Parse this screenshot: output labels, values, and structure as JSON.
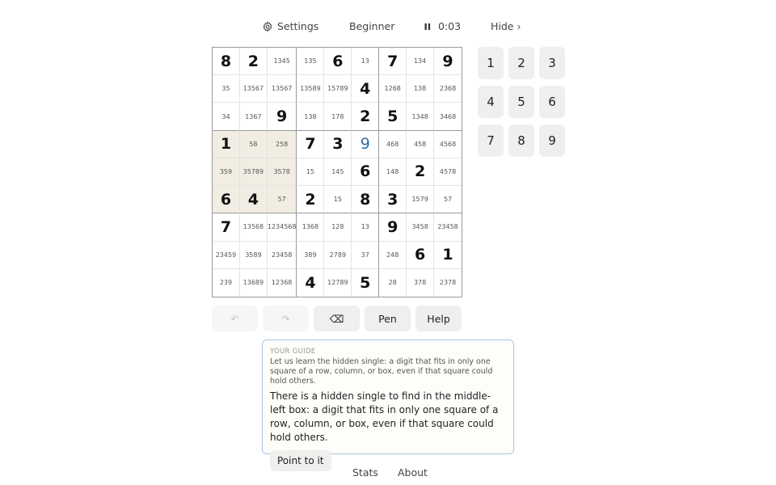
{
  "header": {
    "settings_label": "Settings",
    "difficulty": "Beginner",
    "pause_icon": "pause-icon",
    "timer": "0:03",
    "hide_label": "Hide ›"
  },
  "board": {
    "rows": [
      [
        {
          "v": "8",
          "t": "given"
        },
        {
          "v": "2",
          "t": "given"
        },
        {
          "v": "1345",
          "t": "cand"
        },
        {
          "v": "135",
          "t": "cand"
        },
        {
          "v": "6",
          "t": "given"
        },
        {
          "v": "13",
          "t": "cand"
        },
        {
          "v": "7",
          "t": "given"
        },
        {
          "v": "134",
          "t": "cand"
        },
        {
          "v": "9",
          "t": "given"
        }
      ],
      [
        {
          "v": "35",
          "t": "cand"
        },
        {
          "v": "13567",
          "t": "cand"
        },
        {
          "v": "13567",
          "t": "cand"
        },
        {
          "v": "13589",
          "t": "cand"
        },
        {
          "v": "15789",
          "t": "cand"
        },
        {
          "v": "4",
          "t": "given"
        },
        {
          "v": "1268",
          "t": "cand"
        },
        {
          "v": "138",
          "t": "cand"
        },
        {
          "v": "2368",
          "t": "cand"
        }
      ],
      [
        {
          "v": "34",
          "t": "cand"
        },
        {
          "v": "1367",
          "t": "cand"
        },
        {
          "v": "9",
          "t": "given"
        },
        {
          "v": "138",
          "t": "cand"
        },
        {
          "v": "178",
          "t": "cand"
        },
        {
          "v": "2",
          "t": "given"
        },
        {
          "v": "5",
          "t": "given"
        },
        {
          "v": "1348",
          "t": "cand"
        },
        {
          "v": "3468",
          "t": "cand"
        }
      ],
      [
        {
          "v": "1",
          "t": "given"
        },
        {
          "v": "58",
          "t": "cand"
        },
        {
          "v": "258",
          "t": "cand"
        },
        {
          "v": "7",
          "t": "given"
        },
        {
          "v": "3",
          "t": "given"
        },
        {
          "v": "9",
          "t": "entered"
        },
        {
          "v": "468",
          "t": "cand"
        },
        {
          "v": "458",
          "t": "cand"
        },
        {
          "v": "4568",
          "t": "cand"
        }
      ],
      [
        {
          "v": "359",
          "t": "cand"
        },
        {
          "v": "35789",
          "t": "cand"
        },
        {
          "v": "3578",
          "t": "cand"
        },
        {
          "v": "15",
          "t": "cand"
        },
        {
          "v": "145",
          "t": "cand"
        },
        {
          "v": "6",
          "t": "given"
        },
        {
          "v": "148",
          "t": "cand"
        },
        {
          "v": "2",
          "t": "given"
        },
        {
          "v": "4578",
          "t": "cand"
        }
      ],
      [
        {
          "v": "6",
          "t": "given"
        },
        {
          "v": "4",
          "t": "given"
        },
        {
          "v": "57",
          "t": "cand"
        },
        {
          "v": "2",
          "t": "given"
        },
        {
          "v": "15",
          "t": "cand"
        },
        {
          "v": "8",
          "t": "given"
        },
        {
          "v": "3",
          "t": "given"
        },
        {
          "v": "1579",
          "t": "cand"
        },
        {
          "v": "57",
          "t": "cand"
        }
      ],
      [
        {
          "v": "7",
          "t": "given"
        },
        {
          "v": "13568",
          "t": "cand"
        },
        {
          "v": "1234568",
          "t": "cand"
        },
        {
          "v": "1368",
          "t": "cand"
        },
        {
          "v": "128",
          "t": "cand"
        },
        {
          "v": "13",
          "t": "cand"
        },
        {
          "v": "9",
          "t": "given"
        },
        {
          "v": "3458",
          "t": "cand"
        },
        {
          "v": "23458",
          "t": "cand"
        }
      ],
      [
        {
          "v": "23459",
          "t": "cand"
        },
        {
          "v": "3589",
          "t": "cand"
        },
        {
          "v": "23458",
          "t": "cand"
        },
        {
          "v": "389",
          "t": "cand"
        },
        {
          "v": "2789",
          "t": "cand"
        },
        {
          "v": "37",
          "t": "cand"
        },
        {
          "v": "248",
          "t": "cand"
        },
        {
          "v": "6",
          "t": "given"
        },
        {
          "v": "1",
          "t": "given"
        }
      ],
      [
        {
          "v": "239",
          "t": "cand"
        },
        {
          "v": "13689",
          "t": "cand"
        },
        {
          "v": "12368",
          "t": "cand"
        },
        {
          "v": "4",
          "t": "given"
        },
        {
          "v": "12789",
          "t": "cand"
        },
        {
          "v": "5",
          "t": "given"
        },
        {
          "v": "28",
          "t": "cand"
        },
        {
          "v": "378",
          "t": "cand"
        },
        {
          "v": "2378",
          "t": "cand"
        }
      ]
    ],
    "highlight_box": "middle-left"
  },
  "keypad": [
    "1",
    "2",
    "3",
    "4",
    "5",
    "6",
    "7",
    "8",
    "9"
  ],
  "toolbar": {
    "undo_label": "↶",
    "redo_label": "↷",
    "erase_label": "⌫",
    "pen_label": "Pen",
    "help_label": "Help"
  },
  "guide": {
    "heading": "YOUR GUIDE",
    "intro": "Let us learn the hidden single: a digit that fits in only one square of a row, column, or box, even if that square could hold others.",
    "message": "There is a hidden single to find in the middle-left box: a digit that fits in only one square of a row, column, or box, even if that square could hold others.",
    "button_label": "Point to it"
  },
  "footer": {
    "stats_label": "Stats",
    "about_label": "About"
  },
  "colors": {
    "highlight": "#f2ede3",
    "entered_digit": "#2f6ea6",
    "guide_border": "#a9c3e0",
    "button_bg": "#f0efee"
  }
}
